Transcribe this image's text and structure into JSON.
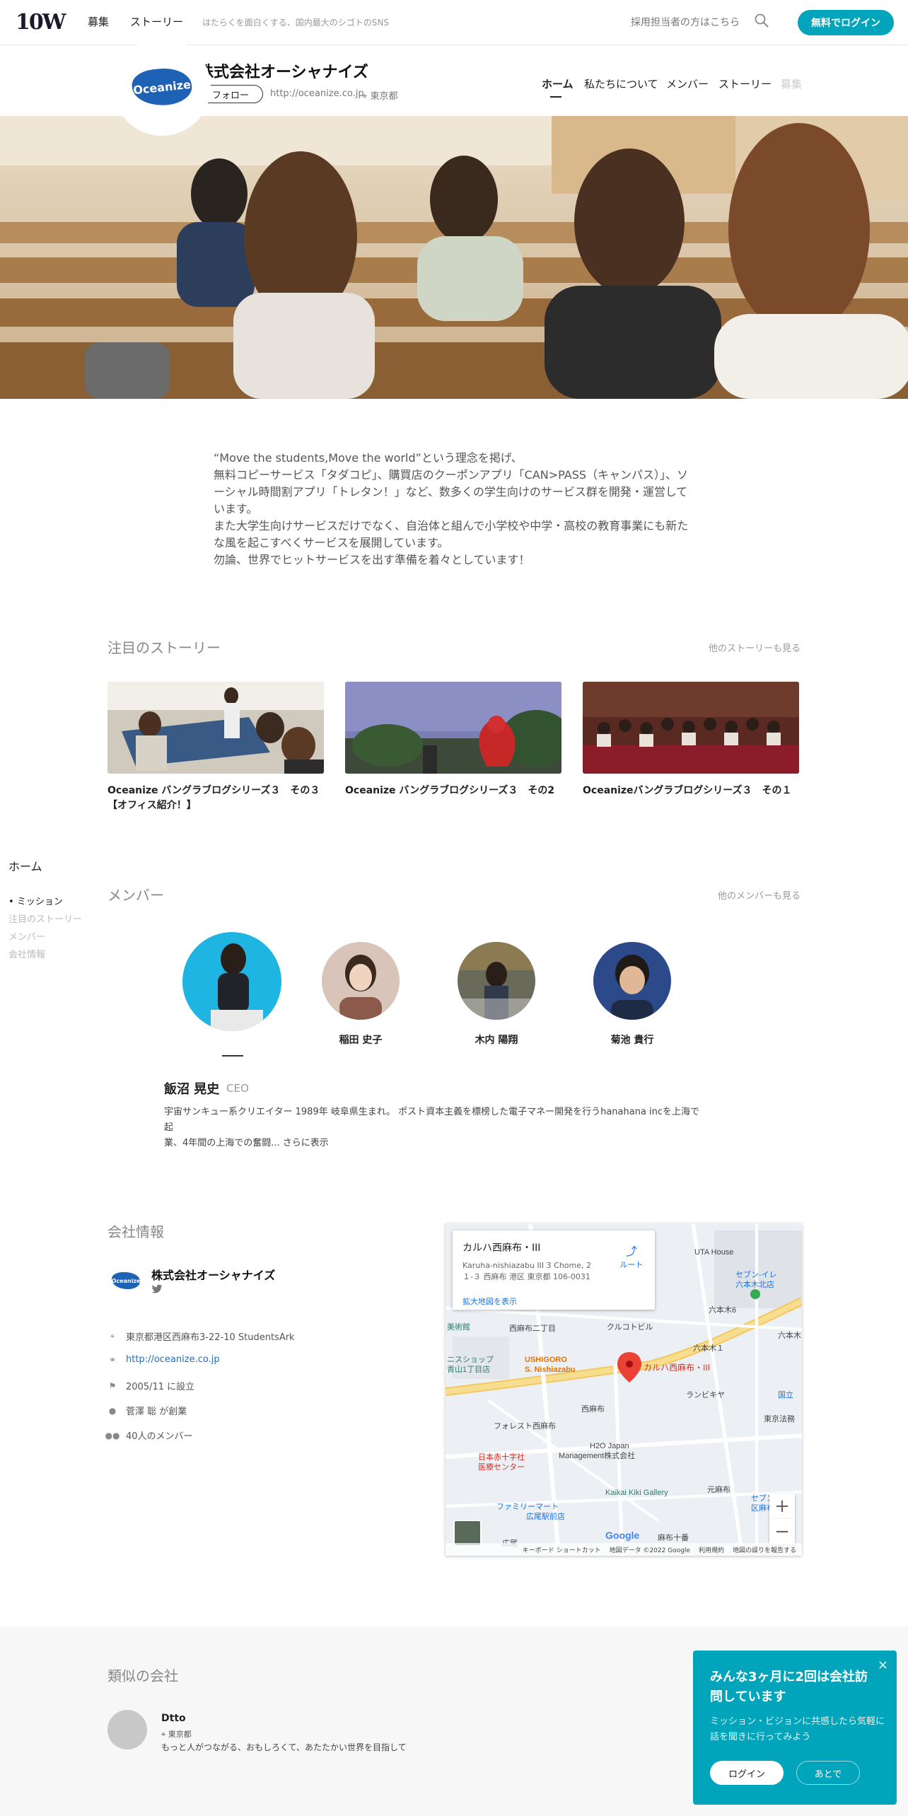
{
  "header": {
    "logo": "10W",
    "nav": [
      "募集",
      "ストーリー"
    ],
    "tagline": "はたらくを面白くする、国内最大のシゴトのSNS",
    "recruiter_link": "採用担当者の方はこちら",
    "login_button": "無料でログイン",
    "accent": "#00a4bb"
  },
  "company": {
    "logo_text": "Oceanize",
    "name": "株式会社オーシャナイズ",
    "follow": "フォロー",
    "url": "http://oceanize.co.jp",
    "location": "東京都",
    "tabs": [
      "ホーム",
      "私たちについて",
      "メンバー",
      "ストーリー",
      "募集"
    ]
  },
  "intro": [
    "“Move the students,Move the world”という理念を掲げ、",
    "無料コピーサービス「タダコピ」、購買店のクーポンアプリ「CAN>PASS（キャンパス）」、ソーシャル時間割アプリ「トレタン！」など、数多くの学生向けのサービス群を開発・運営しています。",
    "また大学生向けサービスだけでなく、自治体と組んで小学校や中学・高校の教育事業にも新たな風を起こすべくサービスを展開しています。",
    "勿論、世界でヒットサービスを出す準備を着々としています！"
  ],
  "stories": {
    "heading": "注目のストーリー",
    "more": "他のストーリーも見る",
    "items": [
      {
        "title": "Oceanize バングラブログシリーズ３　その３【オフィス紹介！】"
      },
      {
        "title": "Oceanize バングラブログシリーズ３　その2"
      },
      {
        "title": "Oceanizeバングラブログシリーズ３　その１"
      }
    ]
  },
  "sidebar": {
    "heading": "ホーム",
    "items": [
      "ミッション",
      "注目のストーリー",
      "メンバー",
      "会社情報"
    ]
  },
  "members": {
    "heading": "メンバー",
    "more": "他のメンバーも見る",
    "people": [
      {
        "name": "稲田 史子"
      },
      {
        "name": "木内 陽翔"
      },
      {
        "name": "菊池 貴行"
      }
    ],
    "featured": {
      "name": "飯沼 晃史",
      "role": "CEO",
      "desc_line1": "宇宙サンキュー系クリエイター 1989年 岐阜県生まれ。 ポスト資本主義を標榜した電子マネー開発を行うhanahana incを上海で起",
      "desc_line2": "業、4年間の上海での奮闘... さらに表示"
    }
  },
  "company_info": {
    "heading": "会社情報",
    "logo_text": "Oceanize",
    "name": "株式会社オーシャナイズ",
    "address": "東京都港区西麻布3-22-10 StudentsArk",
    "url": "http://oceanize.co.jp",
    "founded": "2005/11 に設立",
    "founder": "菅澤 聡 が創業",
    "members": "40人のメンバー"
  },
  "map": {
    "card_title": "カルハ西麻布・III",
    "card_address": "Karuha-nishiazabu III 3 Chome, 2 １-３ 西麻布 港区 東京都 106-0031",
    "card_link": "拡大地図を表示",
    "route": "ルート",
    "pin_label": "カルハ西麻布・III",
    "labels": {
      "uta": "UTA House",
      "seven1a": "セブン-イレ",
      "seven1b": "六本木北店",
      "roppongi6": "六本木6",
      "roppongi": "六本木",
      "nishiazabu2": "西麻布二丁目",
      "kurukotoboru": "クルコトビル",
      "museum": "美術館",
      "roppongi1": "六本木１",
      "ushigoro1": "USHIGORO",
      "ushigoro2": "S. Nishiazabu",
      "lanbikya": "ランビキヤ",
      "kokuritsu": "国立",
      "nishiazabu": "西麻布",
      "tokyohou": "東京法務",
      "forest": "フォレスト西麻布",
      "h2o1": "H2O Japan",
      "h2o2": "Management株式会社",
      "hospital1": "日本赤十字社",
      "hospital2": "医療センター",
      "kaikai": "Kaikai Kiki Gallery",
      "motoazabu": "元麻布",
      "seven2a": "セブン-イレ",
      "seven2b": "区麻布十番",
      "familymart1": "ファミリーマート",
      "familymart2": "広尾駅前店",
      "hiroo": "広尾",
      "azabujuban": "麻布十番",
      "kasuri": "ニスショップ",
      "aoyama": "青山1丁目店"
    },
    "footer": [
      "キーボード ショートカット",
      "地図データ ©2022 Google",
      "利用規約",
      "地図の誤りを報告する"
    ],
    "zoom_in": "+",
    "zoom_out": "−",
    "google": "Google"
  },
  "similar": {
    "heading": "類似の会社",
    "name": "Dtto",
    "location": "東京都",
    "desc": "もっと人がつながる、おもしろくて、あたたかい世界を目指して"
  },
  "popup": {
    "close": "×",
    "heading": "みんな3ヶ月に2回は会社訪問しています",
    "desc": "ミッション・ビジョンに共感したら気軽に話を聞きに行ってみよう",
    "login": "ログイン",
    "later": "あとで"
  }
}
